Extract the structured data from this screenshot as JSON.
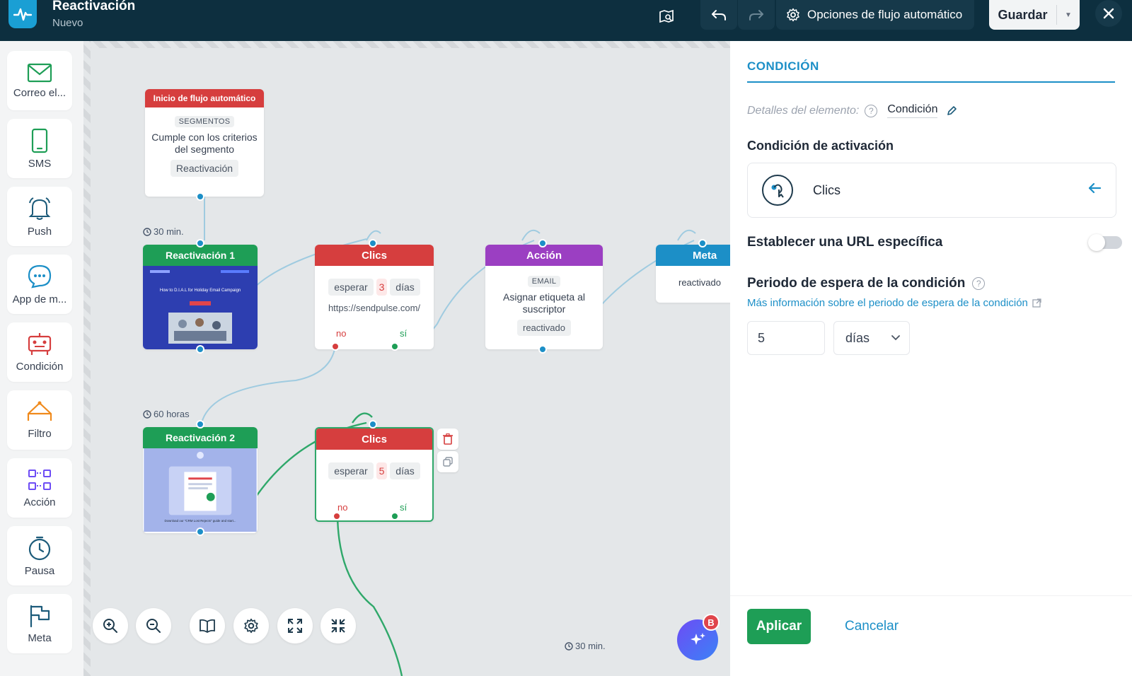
{
  "header": {
    "title": "Reactivación",
    "subtitle": "Nuevo",
    "options_label": "Opciones de flujo automático",
    "save_label": "Guardar"
  },
  "toolbar": {
    "items": [
      {
        "label": "Correo el...",
        "icon": "mail-icon"
      },
      {
        "label": "SMS",
        "icon": "phone-icon"
      },
      {
        "label": "Push",
        "icon": "bell-icon"
      },
      {
        "label": "App de m...",
        "icon": "chat-icon"
      },
      {
        "label": "Condición",
        "icon": "condition-icon"
      },
      {
        "label": "Filtro",
        "icon": "filter-icon"
      },
      {
        "label": "Acción",
        "icon": "action-icon"
      },
      {
        "label": "Pausa",
        "icon": "clock-icon"
      },
      {
        "label": "Meta",
        "icon": "flag-icon"
      }
    ]
  },
  "canvas": {
    "start_node": {
      "header": "Inicio de flujo automático",
      "tag": "SEGMENTOS",
      "text": "Cumple con los criterios del segmento",
      "chip": "Reactivación"
    },
    "delay_1": "30 min.",
    "delay_2": "60 horas",
    "delay_3": "30 min.",
    "email_1": {
      "header": "Reactivación 1",
      "thumb_title": "How to D.I.A.L for Holiday Email Campaign"
    },
    "email_2": {
      "header": "Reactivación 2",
      "thumb_caption": "Download our \"CRM Lost Rejects\" guide and start..."
    },
    "clicks_1": {
      "header": "Clics",
      "wait_label": "esperar",
      "wait_value": "3",
      "wait_unit": "días",
      "url": "https://sendpulse.com/",
      "no": "no",
      "yes": "sí"
    },
    "clicks_2": {
      "header": "Clics",
      "wait_label": "esperar",
      "wait_value": "5",
      "wait_unit": "días",
      "no": "no",
      "yes": "sí"
    },
    "action": {
      "header": "Acción",
      "tag": "EMAIL",
      "text": "Asignar etiqueta al suscriptor",
      "chip": "reactivado"
    },
    "goal": {
      "header": "Meta",
      "text": "reactivado"
    },
    "ai_badge": "B"
  },
  "panel": {
    "title": "CONDICIÓN",
    "details_label": "Detalles del elemento:",
    "details_value": "Condición",
    "activation_label": "Condición de activación",
    "activation_value": "Clics",
    "url_toggle_label": "Establecer una URL específica",
    "url_toggle_on": false,
    "wait_period_label": "Periodo de espera de la condición",
    "more_info_link": "Más información sobre el periodo de espera de la condición",
    "wait_value": "5",
    "wait_unit": "días",
    "apply_label": "Aplicar",
    "cancel_label": "Cancelar"
  },
  "colors": {
    "header_bg": "#0d2f3f",
    "accent_blue": "#1c8fc7",
    "red": "#d63e3e",
    "green": "#1e9e56",
    "purple": "#9b3fc2"
  }
}
